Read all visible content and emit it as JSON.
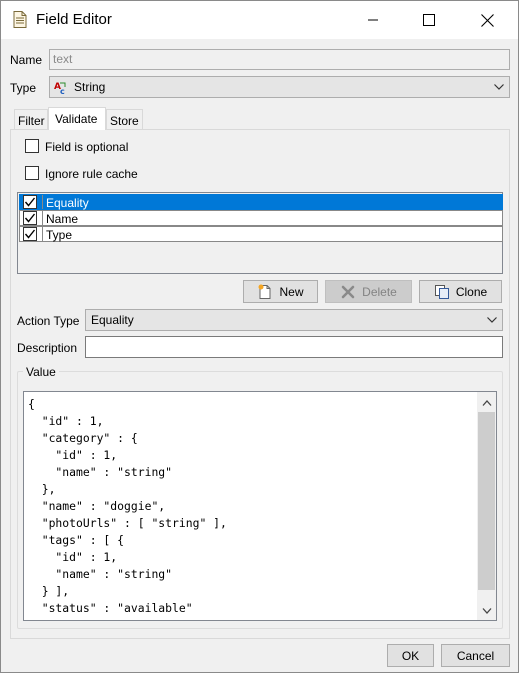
{
  "window": {
    "title": "Field Editor"
  },
  "form": {
    "name_label": "Name",
    "name_value": "text",
    "type_label": "Type",
    "type_value": "String"
  },
  "tabs": [
    {
      "label": "Filter",
      "active": false
    },
    {
      "label": "Validate",
      "active": true
    },
    {
      "label": "Store",
      "active": false
    }
  ],
  "validate": {
    "field_optional_label": "Field is optional",
    "field_optional_checked": false,
    "ignore_cache_label": "Ignore rule cache",
    "ignore_cache_checked": false,
    "rules": [
      {
        "label": "Equality",
        "checked": true,
        "selected": true
      },
      {
        "label": "Name",
        "checked": true,
        "selected": false
      },
      {
        "label": "Type",
        "checked": true,
        "selected": false
      }
    ],
    "buttons": {
      "new": "New",
      "delete": "Delete",
      "clone": "Clone"
    },
    "action_type_label": "Action Type",
    "action_type_value": "Equality",
    "description_label": "Description",
    "description_value": "",
    "value_group_label": "Value",
    "value_code": "{\n  \"id\" : 1,\n  \"category\" : {\n    \"id\" : 1,\n    \"name\" : \"string\"\n  },\n  \"name\" : \"doggie\",\n  \"photoUrls\" : [ \"string\" ],\n  \"tags\" : [ {\n    \"id\" : 1,\n    \"name\" : \"string\"\n  } ],\n  \"status\" : \"available\"\n}"
  },
  "footer": {
    "ok": "OK",
    "cancel": "Cancel"
  },
  "colors": {
    "selection": "#0078d7",
    "window_bg": "#f0f0f0"
  }
}
